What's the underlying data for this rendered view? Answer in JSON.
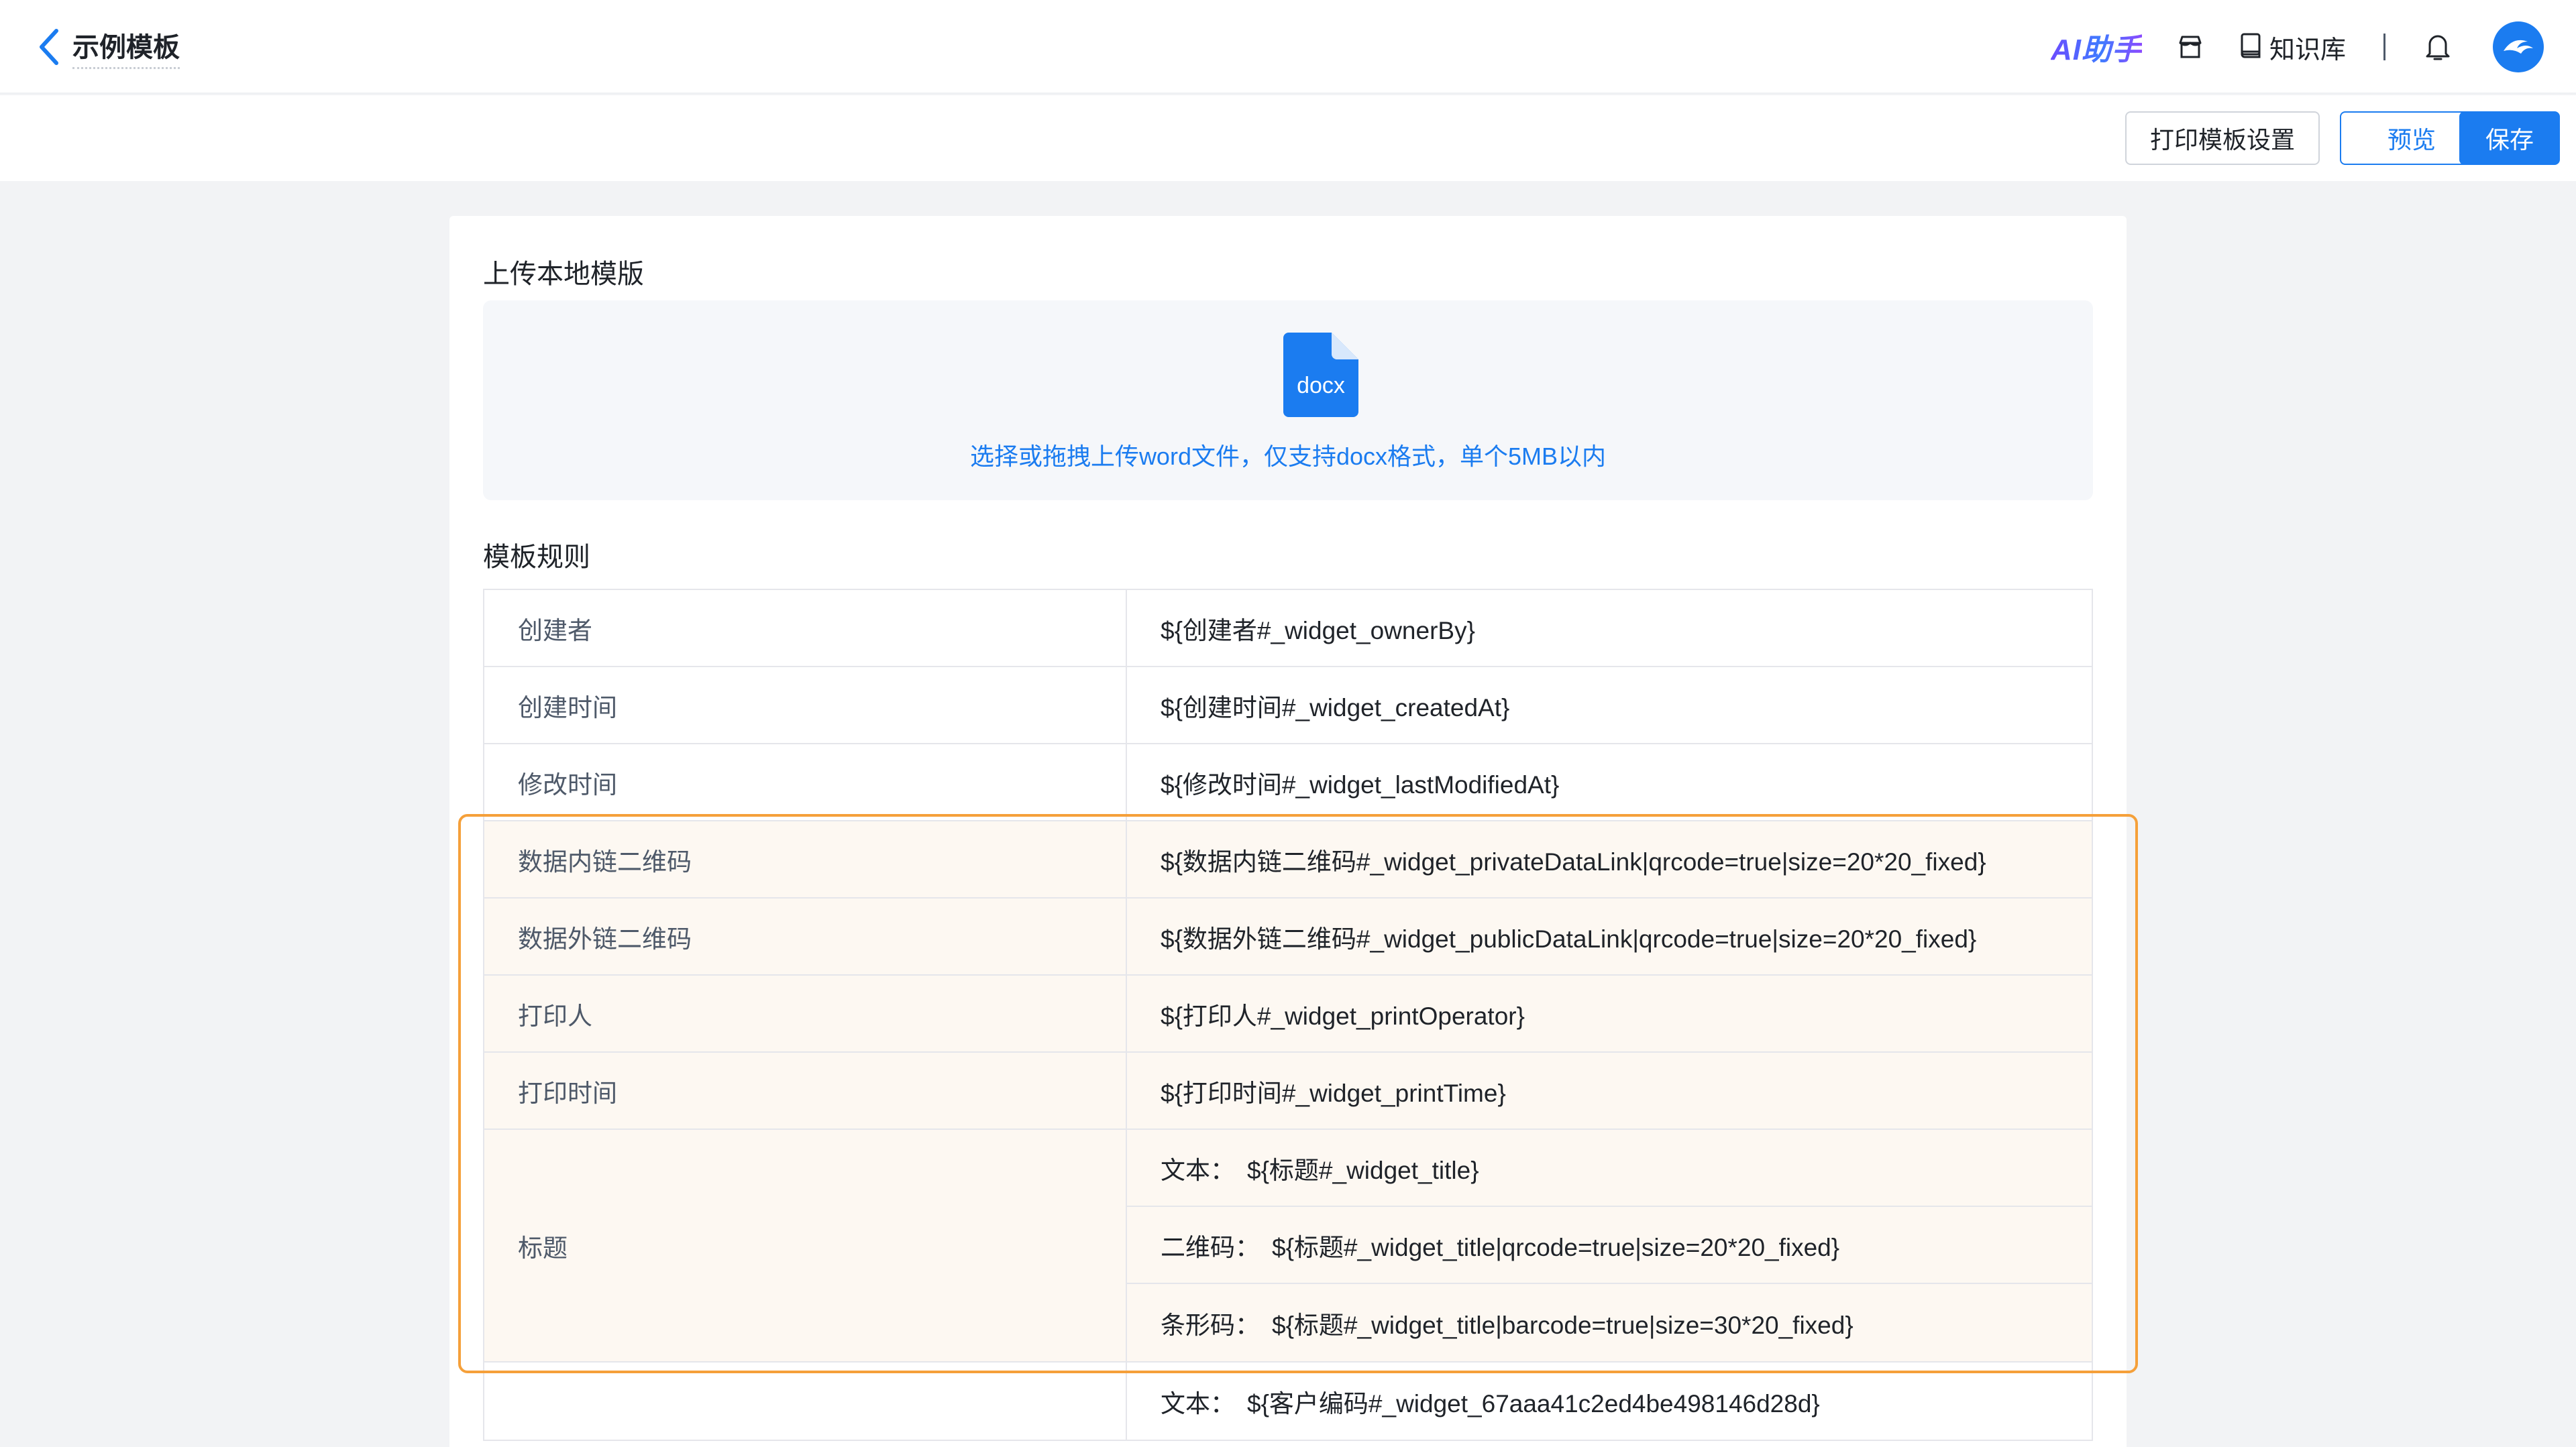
{
  "header": {
    "title": "示例模板",
    "ai_brand": "AI助手",
    "knowledge_base": "知识库"
  },
  "toolbar": {
    "print_settings": "打印模板设置",
    "preview": "预览",
    "save": "保存"
  },
  "upload": {
    "section_title": "上传本地模版",
    "file_type": "docx",
    "hint": "选择或拖拽上传word文件，仅支持docx格式，单个5MB以内"
  },
  "rules": {
    "section_title": "模板规则",
    "rows": [
      {
        "name": "创建者",
        "value": "${创建者#_widget_ownerBy}"
      },
      {
        "name": "创建时间",
        "value": "${创建时间#_widget_createdAt}"
      },
      {
        "name": "修改时间",
        "value": "${修改时间#_widget_lastModifiedAt}"
      },
      {
        "name": "数据内链二维码",
        "value": "${数据内链二维码#_widget_privateDataLink|qrcode=true|size=20*20_fixed}"
      },
      {
        "name": "数据外链二维码",
        "value": "${数据外链二维码#_widget_publicDataLink|qrcode=true|size=20*20_fixed}"
      },
      {
        "name": "打印人",
        "value": "${打印人#_widget_printOperator}"
      },
      {
        "name": "打印时间",
        "value": "${打印时间#_widget_printTime}"
      }
    ],
    "title_group": {
      "name": "标题",
      "subs": [
        {
          "label": "文本：",
          "value": "${标题#_widget_title}"
        },
        {
          "label": "二维码：",
          "value": "${标题#_widget_title|qrcode=true|size=20*20_fixed}"
        },
        {
          "label": "条形码：",
          "value": "${标题#_widget_title|barcode=true|size=30*20_fixed}"
        }
      ]
    },
    "customer_group": {
      "subs": [
        {
          "label": "文本：",
          "value": "${客户编码#_widget_67aaa41c2ed4be498146d28d}"
        }
      ]
    }
  },
  "colors": {
    "primary": "#1b7cf0",
    "highlight_border": "#f5a03a",
    "highlight_fill": "#fdf8f2"
  }
}
